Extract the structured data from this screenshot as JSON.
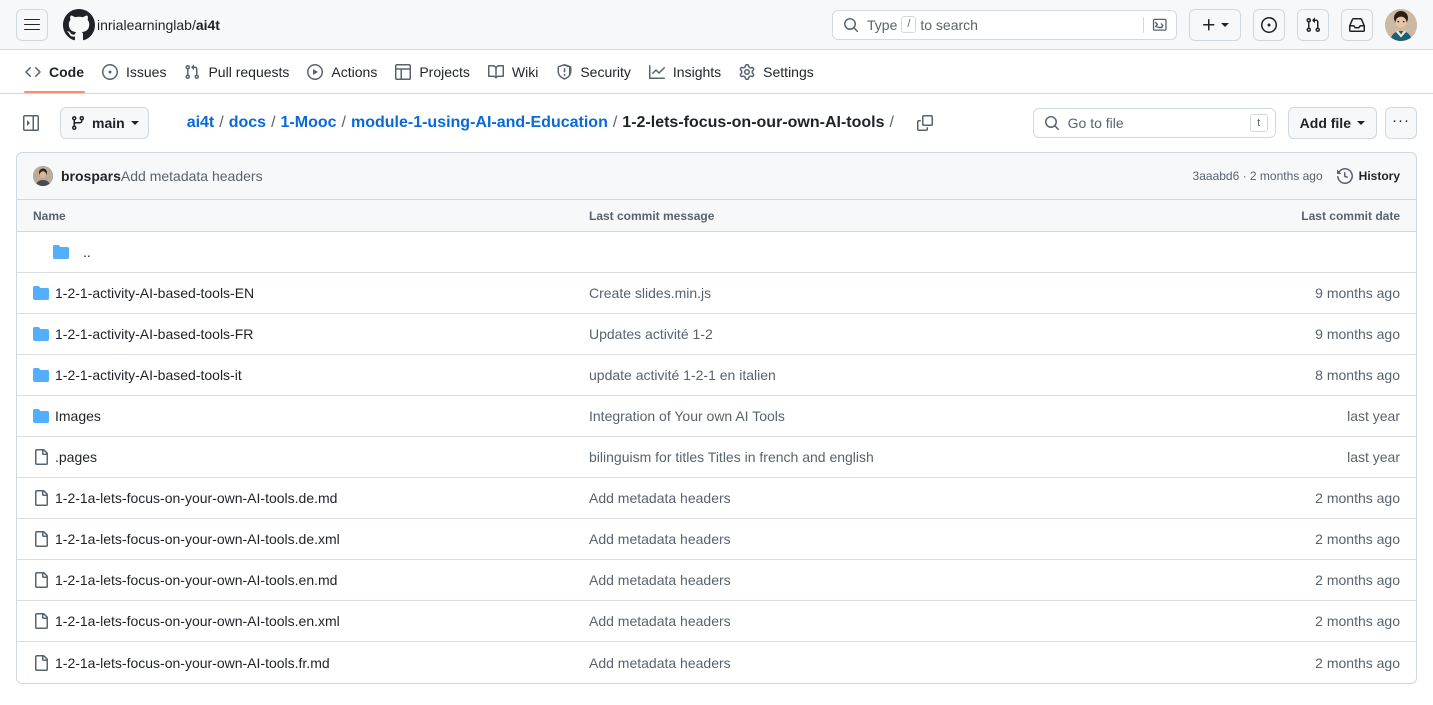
{
  "header": {
    "menu_icon": "hamburger-icon",
    "logo_icon": "github-mark-icon",
    "repo_owner": "inrialearninglab",
    "repo_separator": "/",
    "repo_name": "ai4t",
    "search": {
      "placeholder_prefix": "Type",
      "placeholder_key": "/",
      "placeholder_suffix": "to search",
      "search_icon": "search-icon",
      "command_icon": "terminal-icon"
    },
    "create_new_label": "+",
    "create_new_icon": "plus-icon",
    "issues_icon": "issue-opened-icon",
    "pull_requests_icon": "git-pull-request-icon",
    "inbox_icon": "inbox-icon",
    "avatar_name": "user-avatar"
  },
  "repo_nav": {
    "tabs": [
      {
        "label": "Code",
        "icon": "code-icon",
        "selected": true
      },
      {
        "label": "Issues",
        "icon": "issue-opened-icon",
        "selected": false
      },
      {
        "label": "Pull requests",
        "icon": "git-pull-request-icon",
        "selected": false
      },
      {
        "label": "Actions",
        "icon": "play-icon",
        "selected": false
      },
      {
        "label": "Projects",
        "icon": "table-icon",
        "selected": false
      },
      {
        "label": "Wiki",
        "icon": "book-icon",
        "selected": false
      },
      {
        "label": "Security",
        "icon": "shield-icon",
        "selected": false
      },
      {
        "label": "Insights",
        "icon": "graph-icon",
        "selected": false
      },
      {
        "label": "Settings",
        "icon": "gear-icon",
        "selected": false
      }
    ],
    "selected_underline_color": "#fd8c73"
  },
  "toolbar": {
    "sidebar_toggle_icon": "sidebar-expand-icon",
    "branch_icon": "git-branch-icon",
    "branch_name": "main",
    "copy_path_icon": "copy-icon",
    "breadcrumb": {
      "links": [
        "ai4t",
        "docs",
        "1-Mooc",
        "module-1-using-AI-and-Education"
      ],
      "current": "1-2-lets-focus-on-our-own-AI-tools",
      "separator": "/",
      "trailing_separator": "/"
    },
    "go_to_file": {
      "placeholder": "Go to file",
      "shortcut": "t",
      "search_icon": "search-icon"
    },
    "add_file_label": "Add file",
    "more_options_label": "···"
  },
  "commit_bar": {
    "author": "brospars",
    "message": "Add metadata headers",
    "sha": "3aaabd6",
    "meta": "3aaabd6 · 2 months ago",
    "history_label": "History",
    "history_icon": "history-icon",
    "avatar_name": "commit-author-avatar"
  },
  "table": {
    "columns": {
      "name": "Name",
      "message": "Last commit message",
      "date": "Last commit date"
    },
    "rows": [
      {
        "name": "..",
        "type": "parent",
        "icon": "folder-icon",
        "message": "",
        "date": ""
      },
      {
        "name": "1-2-1-activity-AI-based-tools-EN",
        "type": "folder",
        "icon": "folder-icon",
        "message": "Create slides.min.js",
        "date": "9 months ago"
      },
      {
        "name": "1-2-1-activity-AI-based-tools-FR",
        "type": "folder",
        "icon": "folder-icon",
        "message": "Updates activité 1-2",
        "date": "9 months ago"
      },
      {
        "name": "1-2-1-activity-AI-based-tools-it",
        "type": "folder",
        "icon": "folder-icon",
        "message": "update activité 1-2-1 en italien",
        "date": "8 months ago"
      },
      {
        "name": "Images",
        "type": "folder",
        "icon": "folder-icon",
        "message": "Integration of Your own AI Tools",
        "date": "last year"
      },
      {
        "name": ".pages",
        "type": "file",
        "icon": "file-icon",
        "message": "bilinguism for titles Titles in french and english",
        "date": "last year"
      },
      {
        "name": "1-2-1a-lets-focus-on-your-own-AI-tools.de.md",
        "type": "file",
        "icon": "file-icon",
        "message": "Add metadata headers",
        "date": "2 months ago"
      },
      {
        "name": "1-2-1a-lets-focus-on-your-own-AI-tools.de.xml",
        "type": "file",
        "icon": "file-icon",
        "message": "Add metadata headers",
        "date": "2 months ago"
      },
      {
        "name": "1-2-1a-lets-focus-on-your-own-AI-tools.en.md",
        "type": "file",
        "icon": "file-icon",
        "message": "Add metadata headers",
        "date": "2 months ago"
      },
      {
        "name": "1-2-1a-lets-focus-on-your-own-AI-tools.en.xml",
        "type": "file",
        "icon": "file-icon",
        "message": "Add metadata headers",
        "date": "2 months ago"
      },
      {
        "name": "1-2-1a-lets-focus-on-your-own-AI-tools.fr.md",
        "type": "file",
        "icon": "file-icon",
        "message": "Add metadata headers",
        "date": "2 months ago"
      }
    ]
  },
  "colors": {
    "accent_link": "#0969da",
    "folder_icon": "#54aeff",
    "selected_tab_underline": "#fd8c73",
    "surface": "#f6f8fa",
    "border": "#d1d9e0",
    "text_primary": "#1f2328",
    "text_muted": "#59636e"
  }
}
